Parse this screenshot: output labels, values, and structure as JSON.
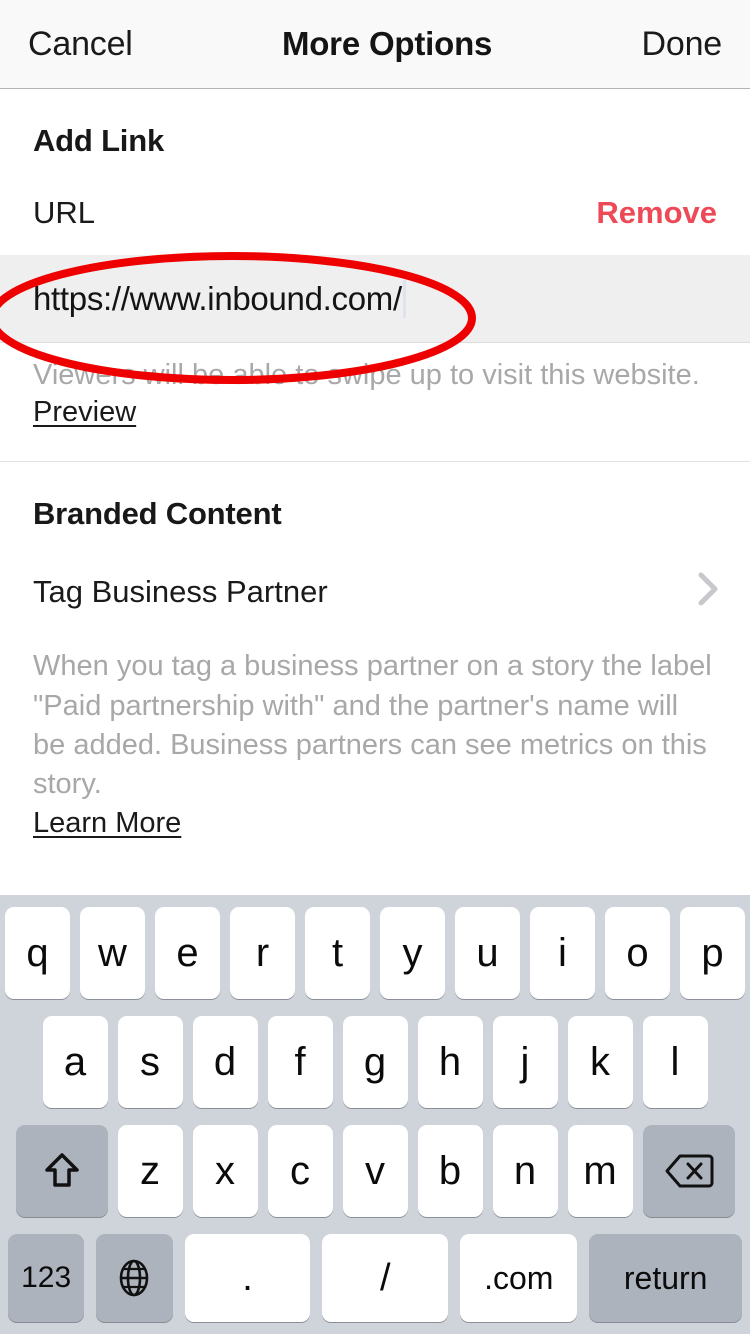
{
  "navbar": {
    "cancel_label": "Cancel",
    "title": "More Options",
    "done_label": "Done"
  },
  "add_link": {
    "section_title": "Add Link",
    "url_label": "URL",
    "remove_label": "Remove",
    "url_value": "https://www.inbound.com/",
    "url_placeholder": "URL",
    "helper_text": "Viewers will be able to swipe up to visit this website.",
    "preview_label": "Preview"
  },
  "branded_content": {
    "section_title": "Branded Content",
    "tag_partner_label": "Tag Business Partner",
    "chevron_icon": "chevron-right-icon",
    "description": "When you tag a business partner on a story the label \"Paid partnership with\" and the partner's name will be added. Business partners can see metrics on this story.",
    "learn_more_label": "Learn More"
  },
  "keyboard": {
    "row1": [
      "q",
      "w",
      "e",
      "r",
      "t",
      "y",
      "u",
      "i",
      "o",
      "p"
    ],
    "row2": [
      "a",
      "s",
      "d",
      "f",
      "g",
      "h",
      "j",
      "k",
      "l"
    ],
    "row3_letters": [
      "z",
      "x",
      "c",
      "v",
      "b",
      "n",
      "m"
    ],
    "shift_icon": "shift-icon",
    "delete_icon": "delete-backspace-icon",
    "numeric_label": "123",
    "globe_icon": "globe-icon",
    "period_label": ".",
    "slash_label": "/",
    "dotcom_label": ".com",
    "return_label": "return"
  },
  "annotation": {
    "shape": "red-ellipse-highlight",
    "color": "#ee0000"
  },
  "colors": {
    "accent_red": "#ed4956",
    "annotation_red": "#ee0000",
    "keyboard_bg": "#cfd3da",
    "key_bg": "#ffffff",
    "key_dark_bg": "#adb3bd",
    "field_bg": "#efefef",
    "navbar_bg": "#f9f9f9"
  }
}
